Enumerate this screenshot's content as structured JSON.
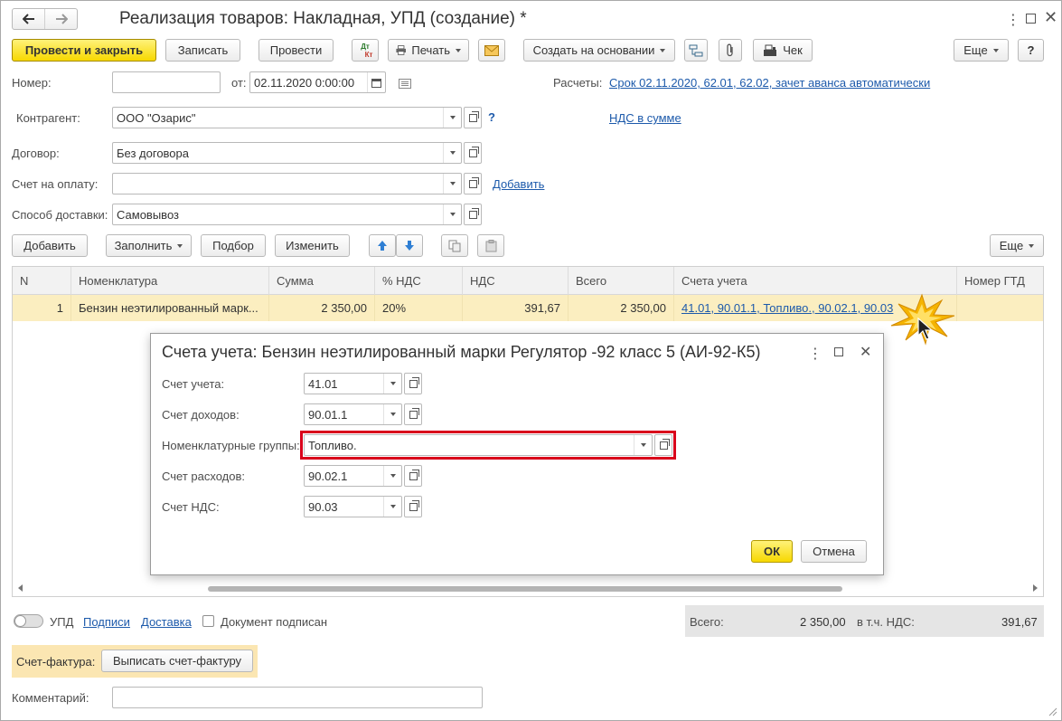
{
  "window": {
    "title": "Реализация товаров: Накладная, УПД (создание) *",
    "back_icon": "arrow-left-icon",
    "forward_icon": "arrow-right-icon"
  },
  "toolbar": {
    "post_close": "Провести и закрыть",
    "save": "Записать",
    "post": "Провести",
    "dtkt_top": "Дт",
    "dtkt_bottom": "Кт",
    "print": "Печать",
    "create_based": "Создать на основании",
    "check": "Чек",
    "more": "Еще",
    "help": "?"
  },
  "header": {
    "number_label": "Номер:",
    "number_value": "",
    "date_label": "от:",
    "date_value": "02.11.2020  0:00:00",
    "settlements_label": "Расчеты:",
    "settlements_link": "Срок 02.11.2020, 62.01, 62.02, зачет аванса автоматически",
    "counterparty_label": "Контрагент:",
    "counterparty_value": "ООО \"Озарис\"",
    "question": "?",
    "vat_link": "НДС в сумме",
    "contract_label": "Договор:",
    "contract_value": "Без договора",
    "invoice_label": "Счет на оплату:",
    "invoice_value": "",
    "add_link": "Добавить",
    "delivery_label": "Способ доставки:",
    "delivery_value": "Самовывоз"
  },
  "table_toolbar": {
    "add": "Добавить",
    "fill": "Заполнить",
    "select": "Подбор",
    "change": "Изменить",
    "more": "Еще"
  },
  "table": {
    "columns": [
      "N",
      "Номенклатура",
      "Сумма",
      "% НДС",
      "НДС",
      "Всего",
      "Счета учета",
      "Номер ГТД"
    ],
    "rows": [
      {
        "n": "1",
        "item": "Бензин неэтилированный марк...",
        "sum": "2 350,00",
        "vat_rate": "20%",
        "vat": "391,67",
        "total": "2 350,00",
        "accounts": "41.01, 90.01.1, Топливо., 90.02.1, 90.03",
        "gtd": ""
      }
    ]
  },
  "modal": {
    "title": "Счета учета: Бензин неэтилированный марки Регулятор -92 класс 5 (АИ-92-К5)",
    "fields": [
      {
        "label": "Счет учета:",
        "value": "41.01"
      },
      {
        "label": "Счет доходов:",
        "value": "90.01.1"
      },
      {
        "label": "Номенклатурные группы:",
        "value": "Топливо."
      },
      {
        "label": "Счет расходов:",
        "value": "90.02.1"
      },
      {
        "label": "Счет НДС:",
        "value": "90.03"
      }
    ],
    "ok": "ОК",
    "cancel": "Отмена",
    "highlight_color": "#d9001b"
  },
  "footer": {
    "upd_label": "УПД",
    "signatures_link": "Подписи",
    "delivery_link": "Доставка",
    "doc_signed_label": "Документ подписан",
    "total_label": "Всего:",
    "total_value": "2 350,00",
    "vat_incl_label": "в т.ч. НДС:",
    "vat_incl_value": "391,67",
    "invoice_label": "Счет-фактура:",
    "issue_invoice": "Выписать счет-фактуру",
    "comment_label": "Комментарий:",
    "comment_value": ""
  },
  "colors": {
    "accent_yellow": "#f7d800",
    "link_blue": "#1d5aab",
    "row_highlight": "#fbeec0",
    "invoice_bg": "#fbe6b2"
  }
}
